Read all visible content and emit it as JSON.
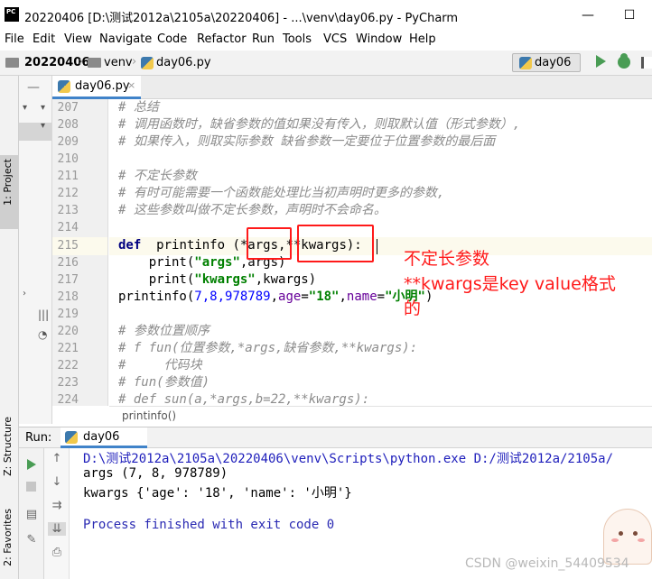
{
  "window": {
    "title": "20220406 [D:\\测试2012a\\2105a\\20220406] - ...\\venv\\day06.py - PyCharm",
    "logo_text": "PC",
    "minimize": "—",
    "maximize": "☐"
  },
  "menu": [
    "File",
    "Edit",
    "View",
    "Navigate",
    "Code",
    "Refactor",
    "Run",
    "Tools",
    "VCS",
    "Window",
    "Help"
  ],
  "nav": {
    "project": "20220406",
    "folder": "venv",
    "file": "day06.py",
    "run_config": "day06"
  },
  "left_strip": {
    "project": "1: Project",
    "structure": "Z: Structure",
    "favorites": "2: Favorites"
  },
  "editor": {
    "tab_label": "day06.py",
    "tab_close": "×",
    "line_numbers": [
      "207",
      "208",
      "209",
      "210",
      "211",
      "212",
      "213",
      "214",
      "215",
      "216",
      "217",
      "218",
      "219",
      "220",
      "221",
      "222",
      "223",
      "224"
    ],
    "lines": {
      "l207": "# 总结",
      "l208": "# 调用函数时，缺省参数的值如果没有传入，则取默认值（形式参数）,",
      "l209": "# 如果传入，则取实际参数 缺省参数一定要位于位置参数的最后面",
      "l211": "# 不定长参数",
      "l212": "# 有时可能需要一个函数能处理比当初声明时更多的参数,",
      "l213": "# 这些参数叫做不定长参数，声明时不会命名。",
      "l215_kw": "def",
      "l215_rest": "  printinfo (*args,**kwargs):",
      "l216_a": "    print(",
      "l216_s": "\"args\"",
      "l216_b": ",args)",
      "l217_a": "    print(",
      "l217_s": "\"kwargs\"",
      "l217_b": ",kwargs)",
      "l218_a": "printinfo(",
      "l218_n": "7,8,978789",
      "l218_c": ",",
      "l218_k1": "age",
      "l218_eq1": "=",
      "l218_s1": "\"18\"",
      "l218_c2": ",",
      "l218_k2": "name",
      "l218_eq2": "=",
      "l218_s2": "\"小明\"",
      "l218_end": ")",
      "l220": "# 参数位置顺序",
      "l221": "# f fun(位置参数,*args,缺省参数,**kwargs):",
      "l222": "#     代码块",
      "l223": "# fun(参数值)",
      "l224": "# def sun(a,*args,b=22,**kwargs):"
    },
    "breadcrumb": "printinfo()"
  },
  "annotations": {
    "line1": "不定长参数",
    "line2": "**kwargs是key  value格式",
    "line3": "的"
  },
  "run_panel": {
    "title": "Run:",
    "tab_label": "day06",
    "console": [
      "D:\\测试2012a\\2105a\\20220406\\venv\\Scripts\\python.exe D:/测试2012a/2105a/",
      "args (7, 8, 978789)",
      "kwargs {'age': '18', 'name': '小明'}",
      "",
      "Process finished with exit code 0"
    ]
  },
  "watermark": "CSDN @weixin_54409534",
  "colors": {
    "keyword": "#000080",
    "string": "#008000",
    "number": "#0000ff",
    "comment": "#8c8c8c",
    "annotation": "#ff1a1a",
    "accent": "#4083c9"
  }
}
